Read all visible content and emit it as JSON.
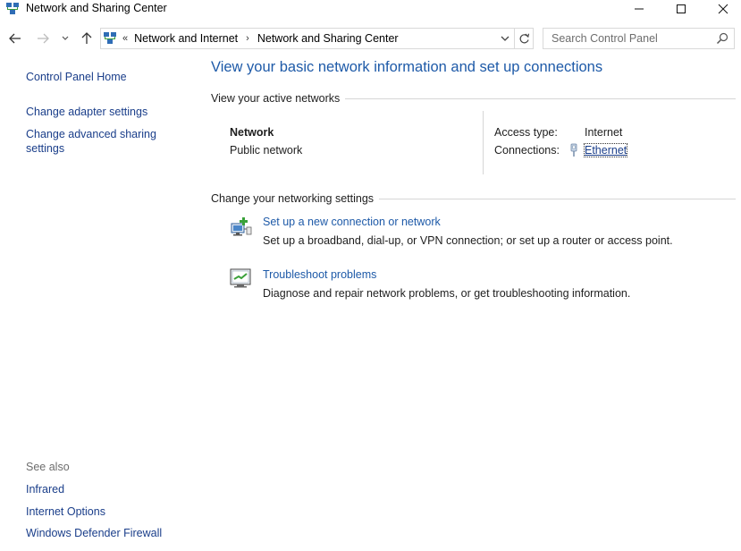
{
  "window": {
    "title": "Network and Sharing Center",
    "icon": "network-sharing-icon"
  },
  "address_bar": {
    "lead": "«",
    "breadcrumbs": [
      "Network and Internet",
      "Network and Sharing Center"
    ],
    "separator": "›"
  },
  "search": {
    "placeholder": "Search Control Panel"
  },
  "left_pane": {
    "home_link": "Control Panel Home",
    "links": [
      "Change adapter settings",
      "Change advanced sharing settings"
    ],
    "see_also_label": "See also",
    "see_also": [
      "Infrared",
      "Internet Options",
      "Windows Defender Firewall"
    ]
  },
  "main": {
    "title": "View your basic network information and set up connections",
    "active_networks_heading": "View your active networks",
    "network": {
      "name": "Network",
      "category": "Public network",
      "access_type_label": "Access type:",
      "access_type_value": "Internet",
      "connections_label": "Connections:",
      "connection_link": "Ethernet"
    },
    "change_settings_heading": "Change your networking settings",
    "tasks": [
      {
        "link": "Set up a new connection or network",
        "description": "Set up a broadband, dial-up, or VPN connection; or set up a router or access point.",
        "icon": "new-connection-icon"
      },
      {
        "link": "Troubleshoot problems",
        "description": "Diagnose and repair network problems, or get troubleshooting information.",
        "icon": "troubleshoot-icon"
      }
    ]
  },
  "colors": {
    "link": "#1a3e8a",
    "title": "#1e5aa8",
    "divider": "#d6d6d6"
  }
}
